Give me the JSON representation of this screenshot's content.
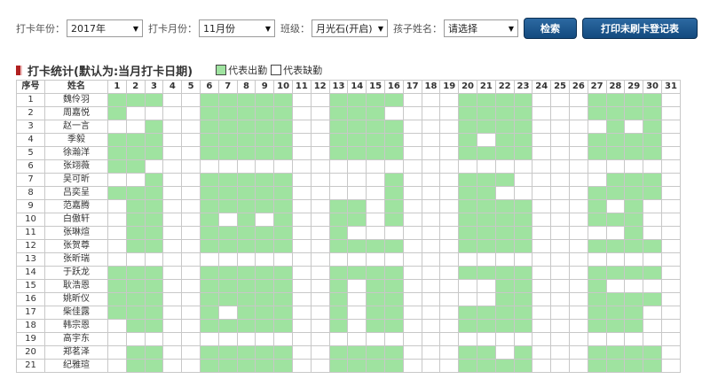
{
  "filters": {
    "year_label": "打卡年份：",
    "year_value": "2017年",
    "month_label": "打卡月份：",
    "month_value": "11月份",
    "class_label": "班级：",
    "class_value": "月光石(开启)",
    "child_label": "孩子姓名：",
    "child_value": "请选择",
    "arrow_icon": "▼"
  },
  "buttons": {
    "search": "检索",
    "print": "打印未刷卡登记表"
  },
  "section": {
    "title": "打卡统计(默认为:当月打卡日期)",
    "legend_present": "代表出勤",
    "legend_absent": "代表缺勤"
  },
  "colors": {
    "present": "#9fe3a0",
    "absent": "#ffffff",
    "title_mark": "#b02020",
    "button": "#1d5a93"
  },
  "table": {
    "col_index": "序号",
    "col_name": "姓名",
    "days": [
      "1",
      "2",
      "3",
      "4",
      "5",
      "6",
      "7",
      "8",
      "9",
      "10",
      "11",
      "12",
      "13",
      "14",
      "15",
      "16",
      "17",
      "18",
      "19",
      "20",
      "21",
      "22",
      "23",
      "24",
      "25",
      "26",
      "27",
      "28",
      "29",
      "30",
      "31"
    ],
    "rows": [
      {
        "no": "1",
        "name": "魏伶羽",
        "att": "111001111100111100011110001111"
      },
      {
        "no": "2",
        "name": "周嘉悦",
        "att": "100001111100111000011110001111"
      },
      {
        "no": "3",
        "name": "赵一言",
        "att": "001001111100111100011110000101"
      },
      {
        "no": "4",
        "name": "季毅",
        "att": "111001111100111100010110001111"
      },
      {
        "no": "5",
        "name": "徐瀚洋",
        "att": "111001111100111100011110001111"
      },
      {
        "no": "6",
        "name": "张翊薇",
        "att": "110000000000000000000000000000"
      },
      {
        "no": "7",
        "name": "吴可昕",
        "att": "001001111100000100011100000111"
      },
      {
        "no": "8",
        "name": "吕奕呈",
        "att": "111001111100000100011000001111"
      },
      {
        "no": "9",
        "name": "范嘉腾",
        "att": "011001111100110100011110001010"
      },
      {
        "no": "10",
        "name": "白傲轩",
        "att": "011001010100110100011110001110"
      },
      {
        "no": "11",
        "name": "张琳煊",
        "att": "011001111100100000011110000010"
      },
      {
        "no": "12",
        "name": "张贺尊",
        "att": "011001111100111100011110001111"
      },
      {
        "no": "13",
        "name": "张昕瑞",
        "att": "000000000000000000000000000000"
      },
      {
        "no": "14",
        "name": "于跃龙",
        "att": "111001111100111100011110001111"
      },
      {
        "no": "15",
        "name": "耿浩恩",
        "att": "111001111100101100000110001000"
      },
      {
        "no": "16",
        "name": "姚昕仪",
        "att": "111001111100101100000110001111"
      },
      {
        "no": "17",
        "name": "柴佳露",
        "att": "111001011100101100011110001110"
      },
      {
        "no": "18",
        "name": "韩宗恩",
        "att": "011001111100101100011110001110"
      },
      {
        "no": "19",
        "name": "高宇东",
        "att": "000000000000000000000000000000"
      },
      {
        "no": "20",
        "name": "郑茗泽",
        "att": "011001111100111100011010001111"
      },
      {
        "no": "21",
        "name": "纪雅瑄",
        "att": "011001111100111100011110001111"
      }
    ]
  }
}
